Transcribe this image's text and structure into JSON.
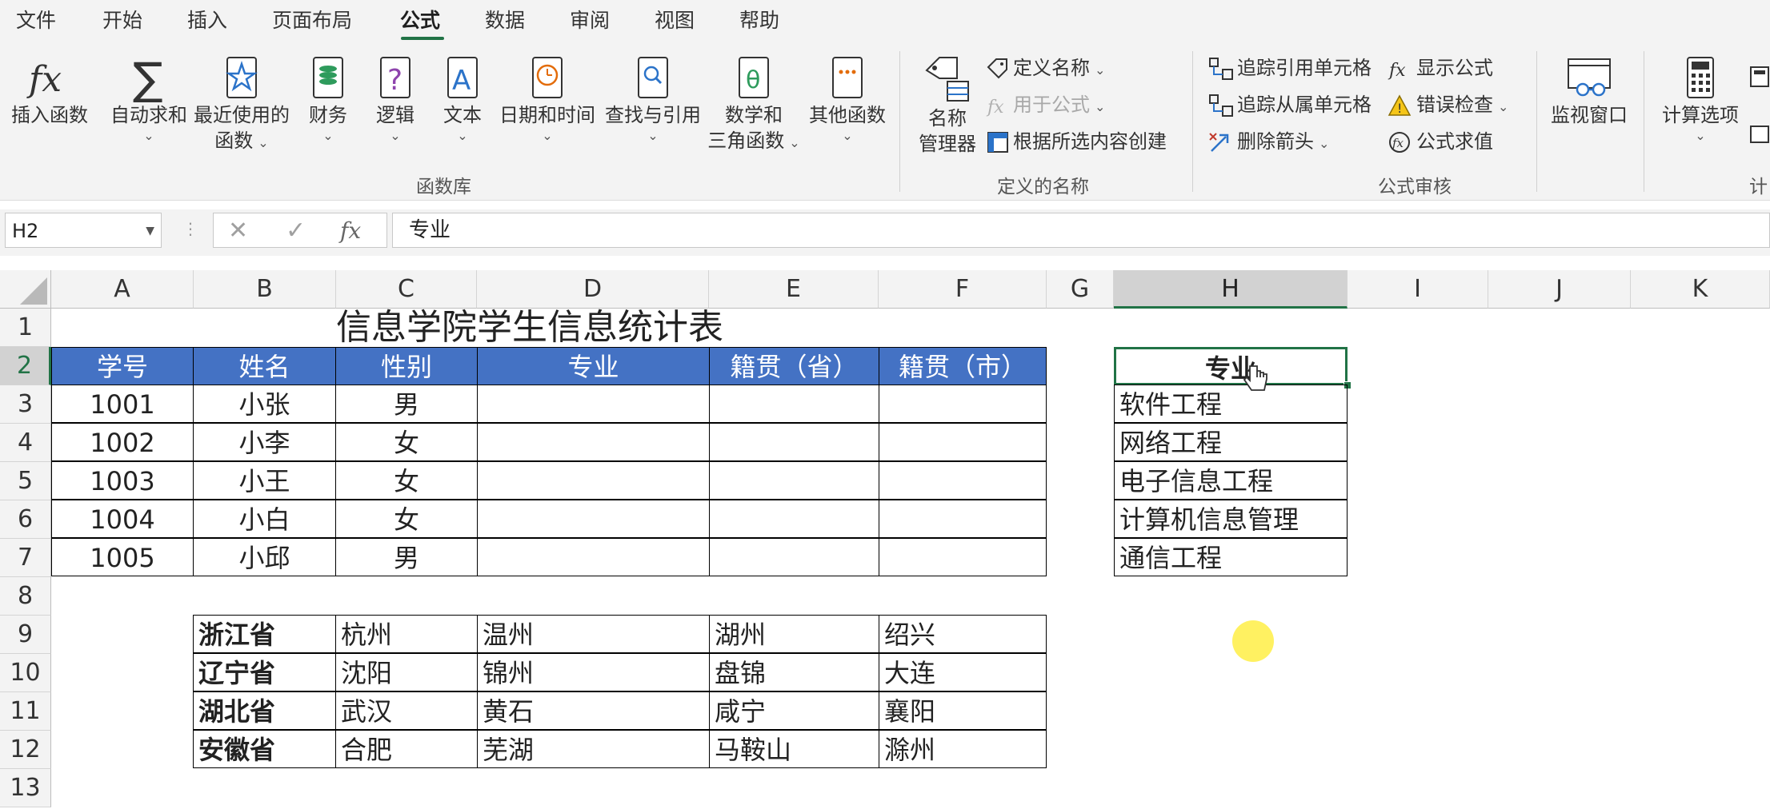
{
  "menu": {
    "tabs": [
      "文件",
      "开始",
      "插入",
      "页面布局",
      "公式",
      "数据",
      "审阅",
      "视图",
      "帮助"
    ],
    "active": "公式"
  },
  "ribbon": {
    "function_library": {
      "insert_function": "插入函数",
      "autosum": "自动求和",
      "recent_line1": "最近使用的",
      "recent_line2": "函数",
      "financial": "财务",
      "logical": "逻辑",
      "text": "文本",
      "datetime": "日期和时间",
      "lookup": "查找与引用",
      "math_line1": "数学和",
      "math_line2": "三角函数",
      "more": "其他函数",
      "group_label": "函数库"
    },
    "defined_names": {
      "name_manager_line1": "名称",
      "name_manager_line2": "管理器",
      "define_name": "定义名称",
      "use_in_formula": "用于公式",
      "create_from_selection": "根据所选内容创建",
      "group_label": "定义的名称"
    },
    "formula_auditing": {
      "trace_precedents": "追踪引用单元格",
      "trace_dependents": "追踪从属单元格",
      "remove_arrows": "删除箭头",
      "show_formulas": "显示公式",
      "error_checking": "错误检查",
      "evaluate_formula": "公式求值",
      "watch_window": "监视窗口",
      "group_label": "公式审核"
    },
    "calculation": {
      "calc_options": "计算选项",
      "group_label_partial": "计"
    }
  },
  "formula_bar": {
    "name_box": "H2",
    "fx": "fx",
    "content": "专业"
  },
  "grid": {
    "columns": [
      "A",
      "B",
      "C",
      "D",
      "E",
      "F",
      "G",
      "H",
      "I",
      "J",
      "K"
    ],
    "rows": [
      "1",
      "2",
      "3",
      "4",
      "5",
      "6",
      "7",
      "8",
      "9",
      "10",
      "11",
      "12",
      "13"
    ],
    "selected_col": "H",
    "selected_row": "2",
    "title": "信息学院学生信息统计表",
    "headers": [
      "学号",
      "姓名",
      "性别",
      "专业",
      "籍贯（省）",
      "籍贯（市）"
    ],
    "students": [
      [
        "1001",
        "小张",
        "男"
      ],
      [
        "1002",
        "小李",
        "女"
      ],
      [
        "1003",
        "小王",
        "女"
      ],
      [
        "1004",
        "小白",
        "女"
      ],
      [
        "1005",
        "小邱",
        "男"
      ]
    ],
    "provinces": [
      [
        "浙江省",
        "杭州",
        "温州",
        "湖州",
        "绍兴"
      ],
      [
        "辽宁省",
        "沈阳",
        "锦州",
        "盘锦",
        "大连"
      ],
      [
        "湖北省",
        "武汉",
        "黄石",
        "咸宁",
        "襄阳"
      ],
      [
        "安徽省",
        "合肥",
        "芜湖",
        "马鞍山",
        "滁州"
      ]
    ],
    "majors_header": "专业",
    "majors": [
      "软件工程",
      "网络工程",
      "电子信息工程",
      "计算机信息管理",
      "通信工程"
    ]
  },
  "colors": {
    "accent": "#217346",
    "header_fill": "#4472c4"
  }
}
